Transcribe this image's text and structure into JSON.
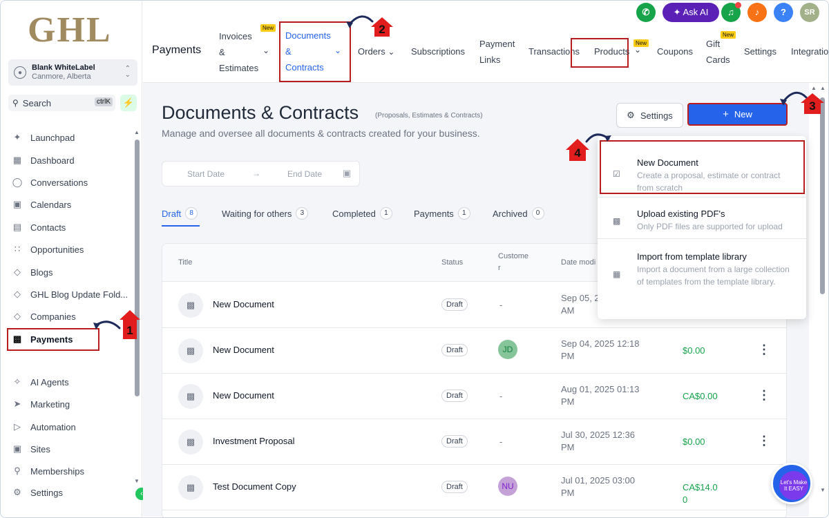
{
  "sidebar": {
    "logo": "GHL",
    "account": {
      "name": "Blank WhiteLabel",
      "location": "Canmore, Alberta"
    },
    "search": {
      "label": "Search",
      "shortcut": "ctrlK"
    },
    "items": [
      {
        "label": "Launchpad",
        "icon": "rocket-icon"
      },
      {
        "label": "Dashboard",
        "icon": "grid-icon"
      },
      {
        "label": "Conversations",
        "icon": "chat-icon"
      },
      {
        "label": "Calendars",
        "icon": "calendar-icon"
      },
      {
        "label": "Contacts",
        "icon": "contacts-icon"
      },
      {
        "label": "Opportunities",
        "icon": "opportunities-icon"
      },
      {
        "label": "Blogs",
        "icon": "blog-icon"
      },
      {
        "label": "GHL Blog Update Fold...",
        "icon": "folder-icon"
      },
      {
        "label": "Companies",
        "icon": "building-icon"
      },
      {
        "label": "Payments",
        "icon": "payments-icon"
      },
      {
        "label": "AI Agents",
        "icon": "sparkle-icon"
      },
      {
        "label": "Marketing",
        "icon": "send-icon"
      },
      {
        "label": "Automation",
        "icon": "automation-icon"
      },
      {
        "label": "Sites",
        "icon": "sites-icon"
      },
      {
        "label": "Memberships",
        "icon": "membership-icon"
      },
      {
        "label": "Settings",
        "icon": "gear-icon"
      }
    ]
  },
  "topbar": {
    "title": "Payments",
    "ask_ai": "Ask AI",
    "avatar": "SR",
    "help": "?",
    "new_tag": "New",
    "tabs": {
      "invoices": [
        "Invoices",
        "&",
        "Estimates"
      ],
      "documents": [
        "Documents",
        "&",
        "Contracts"
      ],
      "orders": "Orders",
      "subscriptions": "Subscriptions",
      "payment_links": [
        "Payment",
        "Links"
      ],
      "transactions": "Transactions",
      "products": "Products",
      "coupons": "Coupons",
      "gift_cards": [
        "Gift",
        "Cards"
      ],
      "settings": "Settings",
      "integrations": "Integratio"
    }
  },
  "main": {
    "title": "Documents & Contracts",
    "title_sub": "(Proposals, Estimates & Contracts)",
    "description": "Manage and oversee all documents & contracts created for your business.",
    "settings_label": "Settings",
    "new_label": "New",
    "start_date": "Start Date",
    "end_date": "End Date",
    "tabs": [
      {
        "label": "Draft",
        "count": "8"
      },
      {
        "label": "Waiting for others",
        "count": "3"
      },
      {
        "label": "Completed",
        "count": "1"
      },
      {
        "label": "Payments",
        "count": "1"
      },
      {
        "label": "Archived",
        "count": "0"
      }
    ],
    "columns": {
      "title": "Title",
      "status": "Status",
      "customer_1": "Custome",
      "customer_2": "r",
      "date": "Date modi"
    },
    "rows": [
      {
        "title": "New Document",
        "status": "Draft",
        "customer": "-",
        "date_1": "Sep 05, 2",
        "date_2": "AM",
        "amount_1": "",
        "amount_2": ""
      },
      {
        "title": "New Document",
        "status": "Draft",
        "customer": "JD",
        "date_1": "Sep 04, 2025 12:18",
        "date_2": "PM",
        "amount_1": "$0.00",
        "amount_2": ""
      },
      {
        "title": "New Document",
        "status": "Draft",
        "customer": "-",
        "date_1": "Aug 01, 2025 01:13",
        "date_2": "PM",
        "amount_1": "CA$0.00",
        "amount_2": ""
      },
      {
        "title": "Investment Proposal",
        "status": "Draft",
        "customer": "-",
        "date_1": "Jul 30, 2025 12:36",
        "date_2": "PM",
        "amount_1": "$0.00",
        "amount_2": ""
      },
      {
        "title": "Test Document Copy",
        "status": "Draft",
        "customer": "NU",
        "date_1": "Jul 01, 2025 03:00",
        "date_2": "PM",
        "amount_1": "CA$14.0",
        "amount_2": "0"
      }
    ]
  },
  "dropdown": [
    {
      "title": "New Document",
      "desc": "Create a proposal, estimate or contract from scratch"
    },
    {
      "title": "Upload existing PDF's",
      "desc": "Only PDF files are supported for upload"
    },
    {
      "title": "Import from template library",
      "desc": "Import a document from a large collection of templates from the template library."
    }
  ],
  "badges": [
    "1",
    "2",
    "3",
    "4"
  ],
  "chat_widget": "Let's Make It EASY",
  "colors": {
    "accent": "#2563eb",
    "highlight_box": "#b91c1c",
    "amount": "#16a34a",
    "ask_ai": "#5b21b6"
  }
}
